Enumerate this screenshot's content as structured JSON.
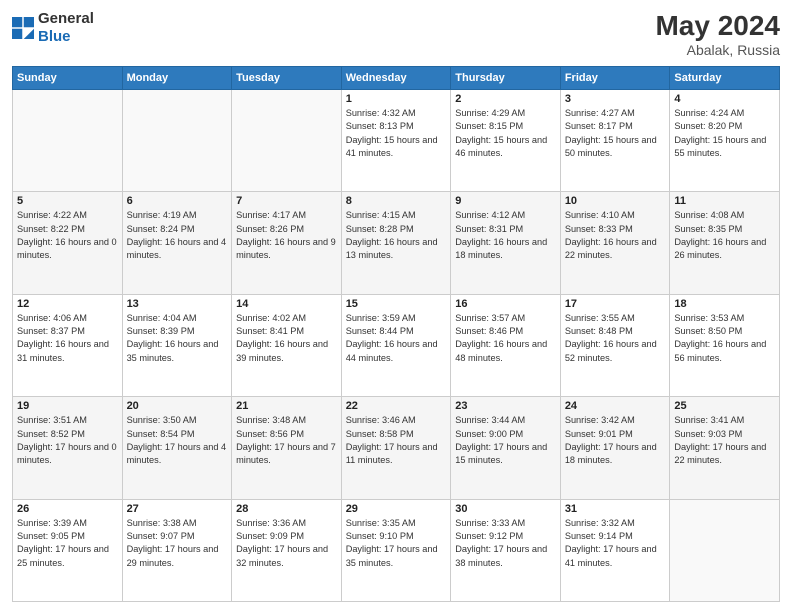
{
  "header": {
    "logo_general": "General",
    "logo_blue": "Blue",
    "title": "May 2024",
    "location": "Abalak, Russia"
  },
  "days_of_week": [
    "Sunday",
    "Monday",
    "Tuesday",
    "Wednesday",
    "Thursday",
    "Friday",
    "Saturday"
  ],
  "weeks": [
    [
      {
        "day": "",
        "sunrise": "",
        "sunset": "",
        "daylight": ""
      },
      {
        "day": "",
        "sunrise": "",
        "sunset": "",
        "daylight": ""
      },
      {
        "day": "",
        "sunrise": "",
        "sunset": "",
        "daylight": ""
      },
      {
        "day": "1",
        "sunrise": "Sunrise: 4:32 AM",
        "sunset": "Sunset: 8:13 PM",
        "daylight": "Daylight: 15 hours and 41 minutes."
      },
      {
        "day": "2",
        "sunrise": "Sunrise: 4:29 AM",
        "sunset": "Sunset: 8:15 PM",
        "daylight": "Daylight: 15 hours and 46 minutes."
      },
      {
        "day": "3",
        "sunrise": "Sunrise: 4:27 AM",
        "sunset": "Sunset: 8:17 PM",
        "daylight": "Daylight: 15 hours and 50 minutes."
      },
      {
        "day": "4",
        "sunrise": "Sunrise: 4:24 AM",
        "sunset": "Sunset: 8:20 PM",
        "daylight": "Daylight: 15 hours and 55 minutes."
      }
    ],
    [
      {
        "day": "5",
        "sunrise": "Sunrise: 4:22 AM",
        "sunset": "Sunset: 8:22 PM",
        "daylight": "Daylight: 16 hours and 0 minutes."
      },
      {
        "day": "6",
        "sunrise": "Sunrise: 4:19 AM",
        "sunset": "Sunset: 8:24 PM",
        "daylight": "Daylight: 16 hours and 4 minutes."
      },
      {
        "day": "7",
        "sunrise": "Sunrise: 4:17 AM",
        "sunset": "Sunset: 8:26 PM",
        "daylight": "Daylight: 16 hours and 9 minutes."
      },
      {
        "day": "8",
        "sunrise": "Sunrise: 4:15 AM",
        "sunset": "Sunset: 8:28 PM",
        "daylight": "Daylight: 16 hours and 13 minutes."
      },
      {
        "day": "9",
        "sunrise": "Sunrise: 4:12 AM",
        "sunset": "Sunset: 8:31 PM",
        "daylight": "Daylight: 16 hours and 18 minutes."
      },
      {
        "day": "10",
        "sunrise": "Sunrise: 4:10 AM",
        "sunset": "Sunset: 8:33 PM",
        "daylight": "Daylight: 16 hours and 22 minutes."
      },
      {
        "day": "11",
        "sunrise": "Sunrise: 4:08 AM",
        "sunset": "Sunset: 8:35 PM",
        "daylight": "Daylight: 16 hours and 26 minutes."
      }
    ],
    [
      {
        "day": "12",
        "sunrise": "Sunrise: 4:06 AM",
        "sunset": "Sunset: 8:37 PM",
        "daylight": "Daylight: 16 hours and 31 minutes."
      },
      {
        "day": "13",
        "sunrise": "Sunrise: 4:04 AM",
        "sunset": "Sunset: 8:39 PM",
        "daylight": "Daylight: 16 hours and 35 minutes."
      },
      {
        "day": "14",
        "sunrise": "Sunrise: 4:02 AM",
        "sunset": "Sunset: 8:41 PM",
        "daylight": "Daylight: 16 hours and 39 minutes."
      },
      {
        "day": "15",
        "sunrise": "Sunrise: 3:59 AM",
        "sunset": "Sunset: 8:44 PM",
        "daylight": "Daylight: 16 hours and 44 minutes."
      },
      {
        "day": "16",
        "sunrise": "Sunrise: 3:57 AM",
        "sunset": "Sunset: 8:46 PM",
        "daylight": "Daylight: 16 hours and 48 minutes."
      },
      {
        "day": "17",
        "sunrise": "Sunrise: 3:55 AM",
        "sunset": "Sunset: 8:48 PM",
        "daylight": "Daylight: 16 hours and 52 minutes."
      },
      {
        "day": "18",
        "sunrise": "Sunrise: 3:53 AM",
        "sunset": "Sunset: 8:50 PM",
        "daylight": "Daylight: 16 hours and 56 minutes."
      }
    ],
    [
      {
        "day": "19",
        "sunrise": "Sunrise: 3:51 AM",
        "sunset": "Sunset: 8:52 PM",
        "daylight": "Daylight: 17 hours and 0 minutes."
      },
      {
        "day": "20",
        "sunrise": "Sunrise: 3:50 AM",
        "sunset": "Sunset: 8:54 PM",
        "daylight": "Daylight: 17 hours and 4 minutes."
      },
      {
        "day": "21",
        "sunrise": "Sunrise: 3:48 AM",
        "sunset": "Sunset: 8:56 PM",
        "daylight": "Daylight: 17 hours and 7 minutes."
      },
      {
        "day": "22",
        "sunrise": "Sunrise: 3:46 AM",
        "sunset": "Sunset: 8:58 PM",
        "daylight": "Daylight: 17 hours and 11 minutes."
      },
      {
        "day": "23",
        "sunrise": "Sunrise: 3:44 AM",
        "sunset": "Sunset: 9:00 PM",
        "daylight": "Daylight: 17 hours and 15 minutes."
      },
      {
        "day": "24",
        "sunrise": "Sunrise: 3:42 AM",
        "sunset": "Sunset: 9:01 PM",
        "daylight": "Daylight: 17 hours and 18 minutes."
      },
      {
        "day": "25",
        "sunrise": "Sunrise: 3:41 AM",
        "sunset": "Sunset: 9:03 PM",
        "daylight": "Daylight: 17 hours and 22 minutes."
      }
    ],
    [
      {
        "day": "26",
        "sunrise": "Sunrise: 3:39 AM",
        "sunset": "Sunset: 9:05 PM",
        "daylight": "Daylight: 17 hours and 25 minutes."
      },
      {
        "day": "27",
        "sunrise": "Sunrise: 3:38 AM",
        "sunset": "Sunset: 9:07 PM",
        "daylight": "Daylight: 17 hours and 29 minutes."
      },
      {
        "day": "28",
        "sunrise": "Sunrise: 3:36 AM",
        "sunset": "Sunset: 9:09 PM",
        "daylight": "Daylight: 17 hours and 32 minutes."
      },
      {
        "day": "29",
        "sunrise": "Sunrise: 3:35 AM",
        "sunset": "Sunset: 9:10 PM",
        "daylight": "Daylight: 17 hours and 35 minutes."
      },
      {
        "day": "30",
        "sunrise": "Sunrise: 3:33 AM",
        "sunset": "Sunset: 9:12 PM",
        "daylight": "Daylight: 17 hours and 38 minutes."
      },
      {
        "day": "31",
        "sunrise": "Sunrise: 3:32 AM",
        "sunset": "Sunset: 9:14 PM",
        "daylight": "Daylight: 17 hours and 41 minutes."
      },
      {
        "day": "",
        "sunrise": "",
        "sunset": "",
        "daylight": ""
      }
    ]
  ]
}
